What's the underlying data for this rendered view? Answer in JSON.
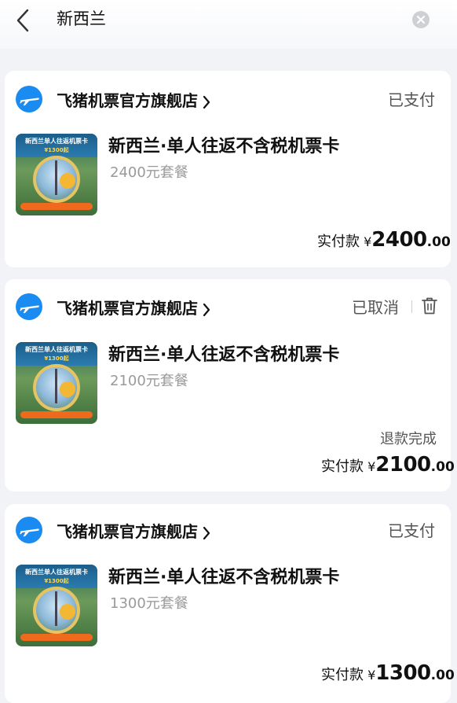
{
  "search": {
    "query": "新西兰"
  },
  "icons": {
    "back": "chevron-left-icon",
    "clear": "clear-circle-icon",
    "shop": "airplane-icon",
    "delete": "trash-icon"
  },
  "colors": {
    "shop_icon_blue": "#1a8bf0",
    "background": "#f2f3f7",
    "thumb_footer": "#f06a1e"
  },
  "orders": [
    {
      "shop_name": "飞猪机票官方旗舰店",
      "status": "已支付",
      "thumb_title": "新西兰单人往返机票卡",
      "thumb_price": "¥1300起",
      "product_name": "新西兰·单人往返不含税机票卡",
      "package": "2400元套餐",
      "price_label": "实付款",
      "currency": "¥",
      "price_int": "2400",
      "price_dec": ".00"
    },
    {
      "shop_name": "飞猪机票官方旗舰店",
      "status": "已取消",
      "thumb_title": "新西兰单人往返机票卡",
      "thumb_price": "¥1300起",
      "product_name": "新西兰·单人往返不含税机票卡",
      "package": "2100元套餐",
      "refund_note": "退款完成",
      "price_label": "实付款",
      "currency": "¥",
      "price_int": "2100",
      "price_dec": ".00"
    },
    {
      "shop_name": "飞猪机票官方旗舰店",
      "status": "已支付",
      "thumb_title": "新西兰单人往返机票卡",
      "thumb_price": "¥1300起",
      "product_name": "新西兰·单人往返不含税机票卡",
      "package": "1300元套餐",
      "price_label": "实付款",
      "currency": "¥",
      "price_int": "1300",
      "price_dec": ".00"
    }
  ]
}
